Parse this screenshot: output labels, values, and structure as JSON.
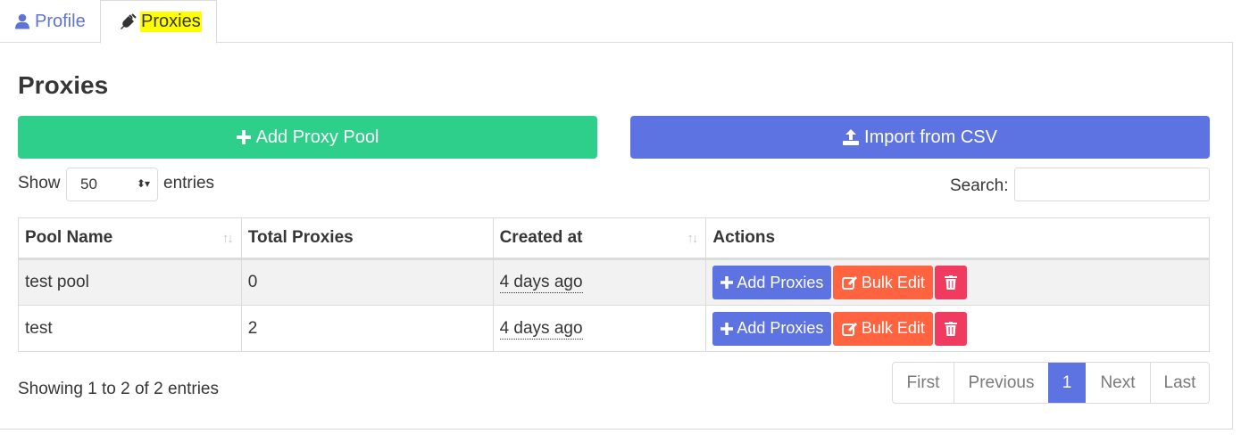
{
  "tabs": [
    {
      "label": "Profile",
      "icon": "user-icon",
      "active": false
    },
    {
      "label": "Proxies",
      "icon": "plug-icon",
      "active": true,
      "highlight": "#ffff00"
    }
  ],
  "page": {
    "title": "Proxies"
  },
  "buttons": {
    "add_pool": {
      "label": "Add Proxy Pool",
      "icon": "plus-icon",
      "color": "#2ecf8a"
    },
    "import_csv": {
      "label": "Import from CSV",
      "icon": "upload-icon",
      "color": "#5d73e2"
    }
  },
  "length_control": {
    "show_label": "Show",
    "entries_label": "entries",
    "selected": "50"
  },
  "search": {
    "label": "Search:",
    "value": ""
  },
  "table": {
    "columns": [
      "Pool Name",
      "Total Proxies",
      "Created at",
      "Actions"
    ],
    "rows": [
      {
        "pool_name": "test pool",
        "total_proxies": "0",
        "created_at": "4 days ago"
      },
      {
        "pool_name": "test",
        "total_proxies": "2",
        "created_at": "4 days ago"
      }
    ],
    "row_actions": {
      "add": "Add Proxies",
      "bulk": "Bulk Edit",
      "delete_icon": "trash-icon"
    }
  },
  "info": "Showing 1 to 2 of 2 entries",
  "pagination": {
    "first": "First",
    "previous": "Previous",
    "current": "1",
    "next": "Next",
    "last": "Last"
  },
  "colors": {
    "primary": "#5d73e2",
    "success": "#2ecf8a",
    "warning": "#ff6340",
    "danger": "#f03a5f"
  }
}
